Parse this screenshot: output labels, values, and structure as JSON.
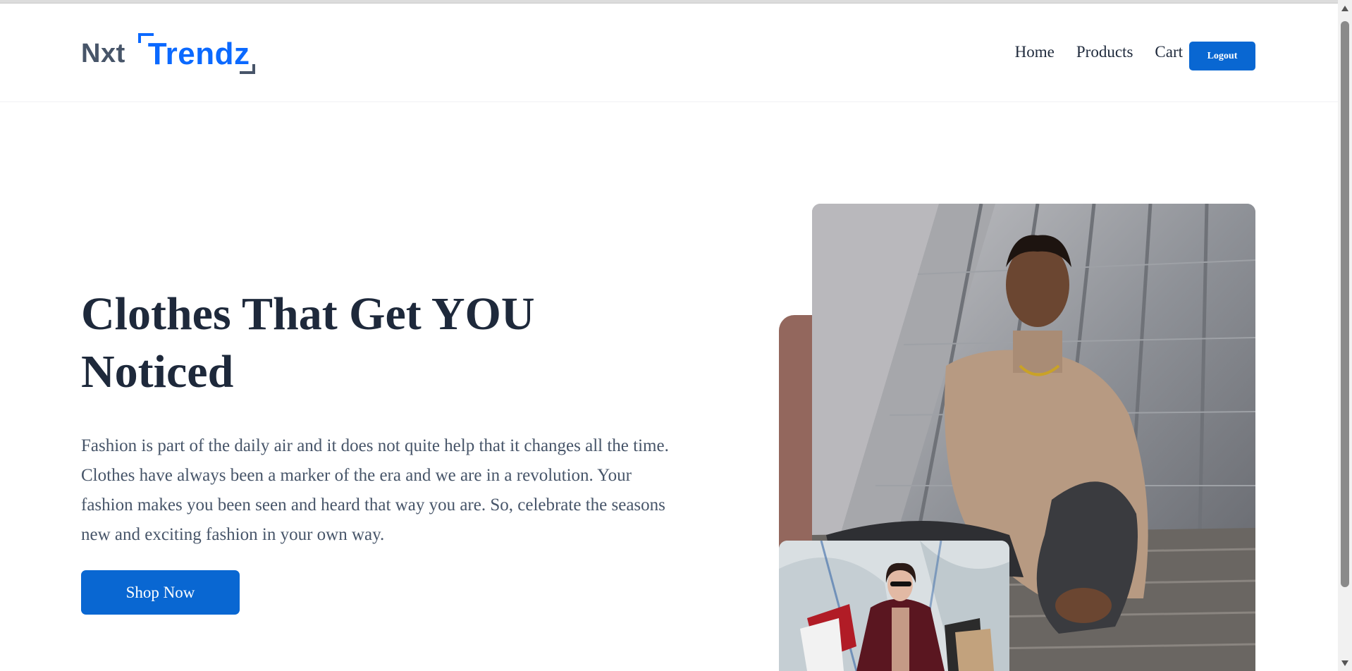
{
  "logo": {
    "part1": "Nxt",
    "part2": "Trendz"
  },
  "nav": {
    "links": [
      "Home",
      "Products",
      "Cart"
    ],
    "logout_label": "Logout"
  },
  "hero": {
    "heading_line1": "Clothes That Get YOU",
    "heading_line2": "Noticed",
    "description": "Fashion is part of the daily air and it does not quite help that it changes all the time. Clothes have always been a marker of the era and we are in a revolution. Your fashion makes you been seen and heard that way you are. So, celebrate the seasons new and exciting fashion in your own way.",
    "shop_label": "Shop Now"
  },
  "colors": {
    "primary": "#0967d2",
    "heading": "#1e293b",
    "text": "#475569",
    "accent": "#93675d"
  },
  "icons": {
    "scroll_up": "triangle-up-icon",
    "scroll_down": "triangle-down-icon"
  }
}
